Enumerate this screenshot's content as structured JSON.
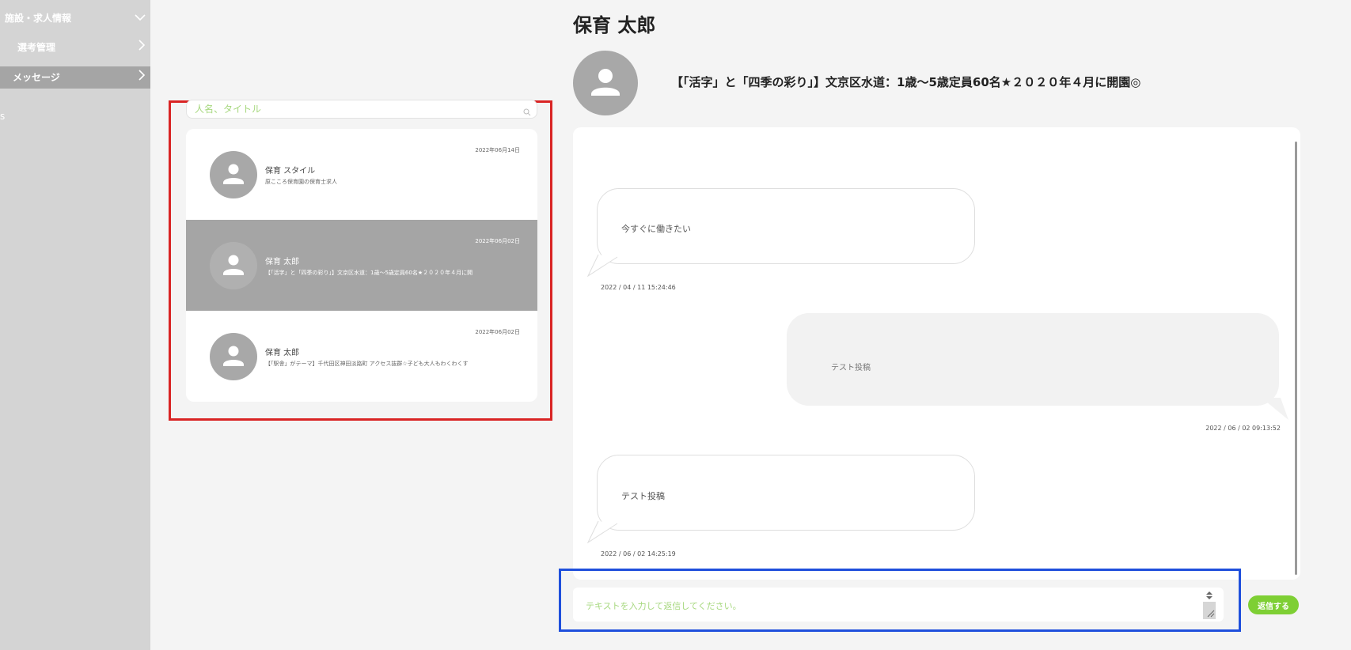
{
  "sidebar": {
    "items": [
      {
        "label": "施設・求人情報",
        "chevron": "chevron-down-icon"
      },
      {
        "label": "選考管理",
        "chevron": "chevron-right-icon"
      },
      {
        "label": "メッセージ",
        "chevron": "chevron-right-icon",
        "active": true
      }
    ],
    "stub": "s"
  },
  "search": {
    "placeholder": "人名、タイトル",
    "icon": "search-icon"
  },
  "conversations": [
    {
      "date": "2022年06月14日",
      "name": "保育 スタイル",
      "preview": "原こころ保育園の保育士求人",
      "selected": false
    },
    {
      "date": "2022年06月02日",
      "name": "保育 太郎",
      "preview": "【「活字」と「四季の彩り」】文京区水道：1歳〜5歳定員60名★２０２０年４月に開",
      "selected": true
    },
    {
      "date": "2022年06月02日",
      "name": "保育 太郎",
      "preview": "【「駅舎」がテーマ】千代田区神田淡路町 アクセス抜群☆子ども大人もわくわくす",
      "selected": false
    }
  ],
  "header": {
    "title": "保育 太郎",
    "job_title": "【「活字」と「四季の彩り」】文京区水道：1歳〜5歳定員60名★２０２０年４月に開園◎"
  },
  "messages": [
    {
      "text": "今すぐに働きたい",
      "timestamp": "2022 / 04 / 11 15:24:46",
      "direction": "in"
    },
    {
      "text": "テスト投稿",
      "timestamp": "2022 / 06 / 02 09:13:52",
      "direction": "out"
    },
    {
      "text": "テスト投稿",
      "timestamp": "2022 / 06 / 02 14:25:19",
      "direction": "in"
    }
  ],
  "composer": {
    "placeholder": "テキストを入力して返信してください。",
    "send_label": "返信する"
  },
  "colors": {
    "accent": "#7ecf34",
    "placeholder": "#a7d87f",
    "sidebar": "#d4d4d4",
    "selected": "#a5a5a5",
    "annot_red": "#d92424",
    "annot_blue": "#1f4fdc"
  }
}
